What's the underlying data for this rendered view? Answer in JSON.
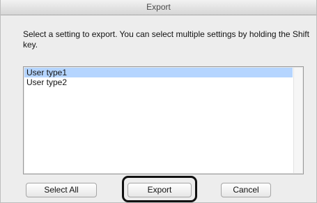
{
  "window": {
    "title": "Export"
  },
  "dialog": {
    "message": "Select a setting to export. You can select multiple settings by holding the Shift key.",
    "list": {
      "items": [
        {
          "label": "User type1",
          "selected": true
        },
        {
          "label": "User type2",
          "selected": false
        }
      ]
    },
    "buttons": {
      "select_all": "Select All",
      "export": "Export",
      "cancel": "Cancel"
    }
  },
  "colors": {
    "selection": "#b5d5ff",
    "highlight_ring": "#111111"
  }
}
